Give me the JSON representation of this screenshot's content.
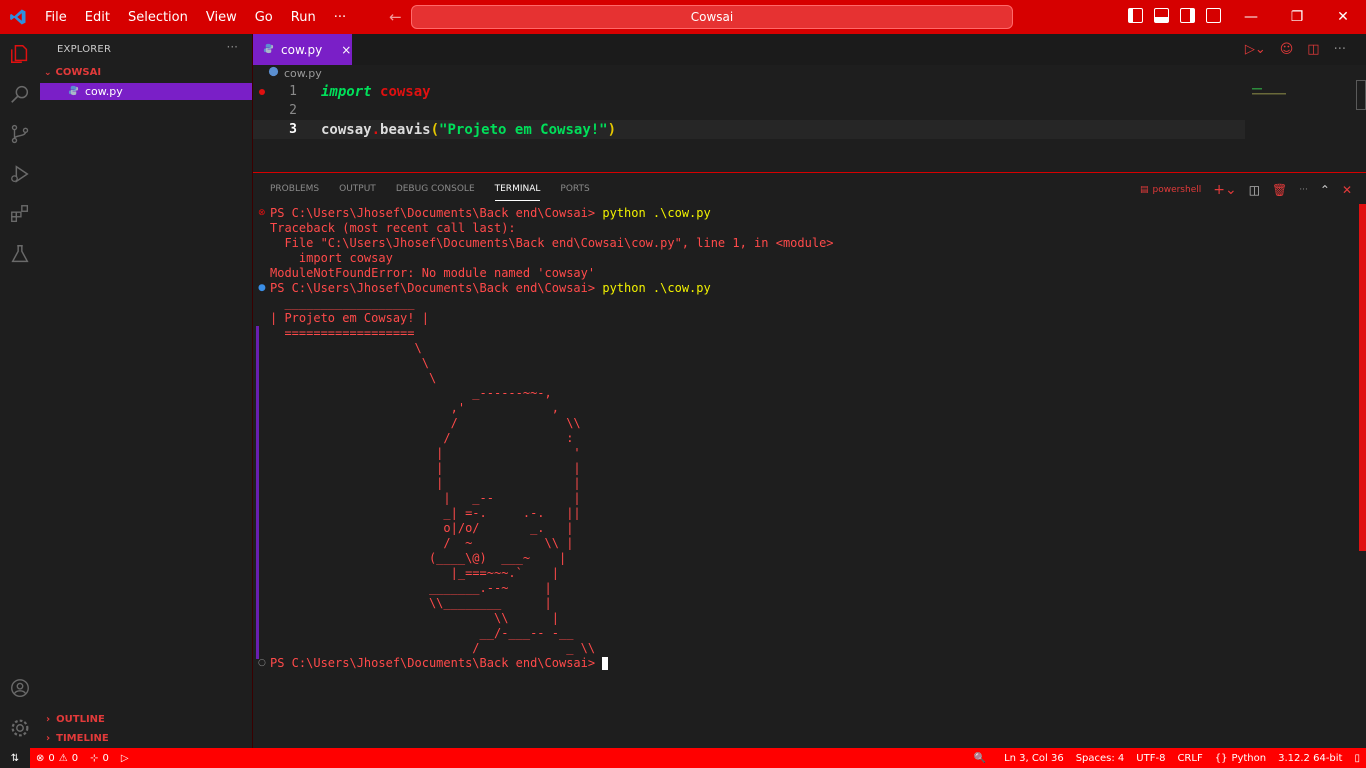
{
  "titlebar": {
    "menu": [
      "File",
      "Edit",
      "Selection",
      "View",
      "Go",
      "Run",
      "···"
    ],
    "search": "Cowsai",
    "accent": "#d60000"
  },
  "sidebar": {
    "title": "EXPLORER",
    "dots": "···",
    "folder": "COWSAI",
    "file": "cow.py",
    "outline": "OUTLINE",
    "timeline": "TIMELINE"
  },
  "editor": {
    "tab": "cow.py",
    "tab_close": "×",
    "breadcrumb": "cow.py",
    "lines": [
      {
        "number": "1",
        "keyword": "import",
        "module": "cowsay"
      },
      {
        "number": "2"
      },
      {
        "number": "3",
        "obj": "cowsay",
        "dot": ".",
        "fn": "beavis",
        "open": "(",
        "str": "\"Projeto em Cowsay!\"",
        "close": ")"
      }
    ]
  },
  "panel": {
    "tabs": [
      "PROBLEMS",
      "OUTPUT",
      "DEBUG CONSOLE",
      "TERMINAL",
      "PORTS"
    ],
    "shell": "powershell",
    "terminal": {
      "prompt1": "PS C:\\Users\\Jhosef\\Documents\\Back end\\Cowsai> ",
      "cmd1": "python .\\cow.py",
      "tb1": "Traceback (most recent call last):",
      "tb2": "  File \"C:\\Users\\Jhosef\\Documents\\Back end\\Cowsai\\cow.py\", line 1, in <module>",
      "tb3": "    import cowsay",
      "tb4": "ModuleNotFoundError: No module named 'cowsay'",
      "prompt2": "PS C:\\Users\\Jhosef\\Documents\\Back end\\Cowsai> ",
      "cmd2": "python .\\cow.py",
      "art": [
        "  __________________",
        "| Projeto em Cowsay! |",
        "  ==================",
        "                    \\",
        "                     \\",
        "                      \\",
        "                            _------~~-,",
        "                         ,'            ,",
        "                         /               \\\\",
        "                        /                :",
        "                       |                  '",
        "                       |                  |",
        "                       |                  |",
        "                        |   _--           |",
        "                        _| =-.     .-.   ||",
        "                        o|/o/       _.   |",
        "                        /  ~          \\\\ |",
        "                      (____\\@)  ___~    |",
        "                         |_===~~~.`    |",
        "                      _______.--~     |",
        "                      \\\\________      |",
        "                               \\\\      |",
        "                             __/-___-- -__",
        "                            /            _ \\\\"
      ],
      "prompt3": "PS C:\\Users\\Jhosef\\Documents\\Back end\\Cowsai> "
    }
  },
  "status": {
    "errors": "0",
    "warnings": "0",
    "ports": "0",
    "position": "Ln 3, Col 36",
    "spaces": "Spaces: 4",
    "encoding": "UTF-8",
    "eol": "CRLF",
    "language": "Python",
    "interpreter": "3.12.2 64-bit"
  }
}
